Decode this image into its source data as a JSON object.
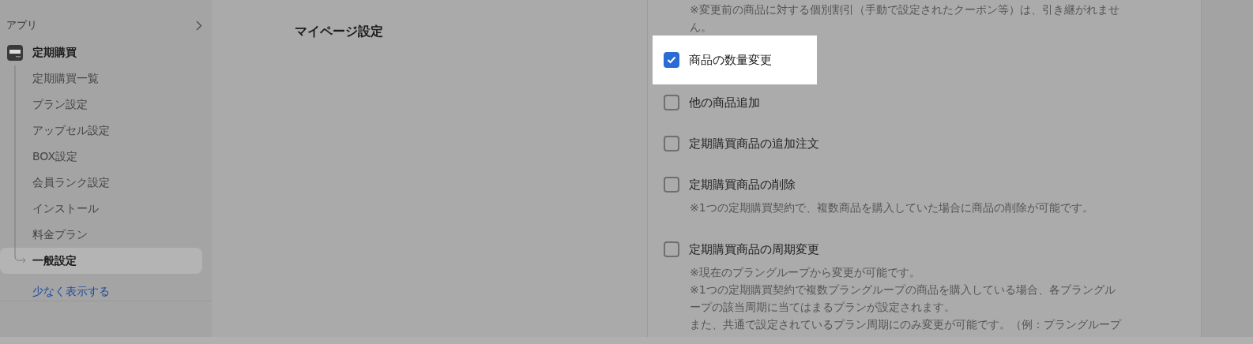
{
  "sidebar": {
    "section_title": "アプリ",
    "app": {
      "name": "定期購買",
      "items": [
        {
          "label": "定期購買一覧",
          "selected": false
        },
        {
          "label": "プラン設定",
          "selected": false
        },
        {
          "label": "アップセル設定",
          "selected": false
        },
        {
          "label": "BOX設定",
          "selected": false
        },
        {
          "label": "会員ランク設定",
          "selected": false
        },
        {
          "label": "インストール",
          "selected": false
        },
        {
          "label": "料金プラン",
          "selected": false
        },
        {
          "label": "一般設定",
          "selected": true
        }
      ]
    },
    "show_less": "少なく表示する"
  },
  "section": {
    "title": "マイページ設定",
    "leading_note": [
      "※変更前の商品に対する個別割引（手動で設定されたクーポン等）は、引き継がれませ",
      "ん。"
    ],
    "options": [
      {
        "label": "商品の数量変更",
        "checked": true,
        "highlighted": true
      },
      {
        "label": "他の商品追加",
        "checked": false,
        "highlighted": false
      },
      {
        "label": "定期購買商品の追加注文",
        "checked": false,
        "highlighted": false
      },
      {
        "label": "定期購買商品の削除",
        "checked": false,
        "highlighted": false,
        "notes": [
          "※1つの定期購買契約で、複数商品を購入していた場合に商品の削除が可能です。"
        ]
      },
      {
        "label": "定期購買商品の周期変更",
        "checked": false,
        "highlighted": false,
        "notes": [
          "※現在のプラングループから変更が可能です。",
          "※1つの定期購買契約で複数プラングループの商品を購入している場合、各プラングル",
          "ープの該当周期に当てはまるプランが設定されます。",
          "また、共通で設定されているプラン周期にのみ変更が可能です。（例：プラングループ"
        ]
      }
    ]
  }
}
